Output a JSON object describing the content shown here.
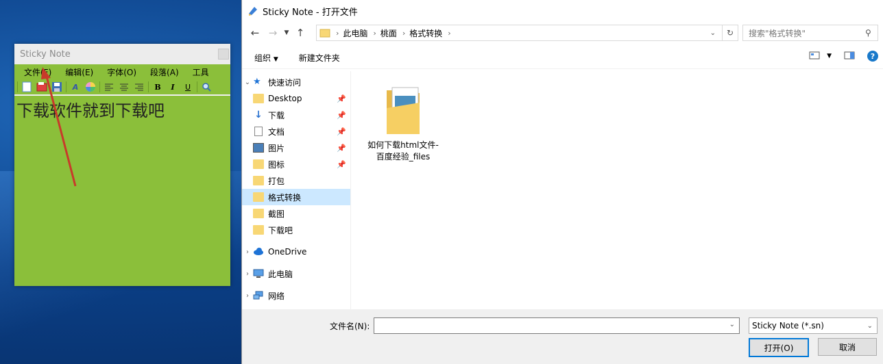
{
  "sticky": {
    "title": "Sticky Note",
    "menu": [
      "文件(F)",
      "编辑(E)",
      "字体(O)",
      "段落(A)",
      "工具"
    ],
    "content": "下载软件就到下载吧"
  },
  "dialog": {
    "title": "Sticky Note - 打开文件",
    "breadcrumb": [
      "此电脑",
      "桃面",
      "格式转换"
    ],
    "search_placeholder": "搜索\"格式转换\"",
    "toolbar": {
      "organize": "组织",
      "new_folder": "新建文件夹"
    },
    "nav": {
      "quick_access": "快速访问",
      "items": [
        {
          "label": "Desktop",
          "icon": "desktop-folder-icon",
          "pinned": true
        },
        {
          "label": "下载",
          "icon": "download-arrow-icon",
          "pinned": true
        },
        {
          "label": "文档",
          "icon": "document-icon",
          "pinned": true
        },
        {
          "label": "图片",
          "icon": "pictures-icon",
          "pinned": true
        },
        {
          "label": "图标",
          "icon": "folder-icon",
          "pinned": true
        },
        {
          "label": "打包",
          "icon": "folder-icon",
          "pinned": false
        },
        {
          "label": "格式转换",
          "icon": "folder-icon",
          "pinned": false,
          "selected": true
        },
        {
          "label": "截图",
          "icon": "folder-icon",
          "pinned": false
        },
        {
          "label": "下载吧",
          "icon": "folder-icon",
          "pinned": false
        }
      ],
      "onedrive": "OneDrive",
      "this_pc": "此电脑",
      "network": "网络"
    },
    "files": [
      {
        "name": "如何下载html文件-百度经验_files",
        "icon": "folder-with-preview-icon"
      }
    ],
    "filename_label": "文件名(N):",
    "filename_value": "",
    "filetype": "Sticky Note (*.sn)",
    "open_button": "打开(O)",
    "cancel_button": "取消"
  }
}
